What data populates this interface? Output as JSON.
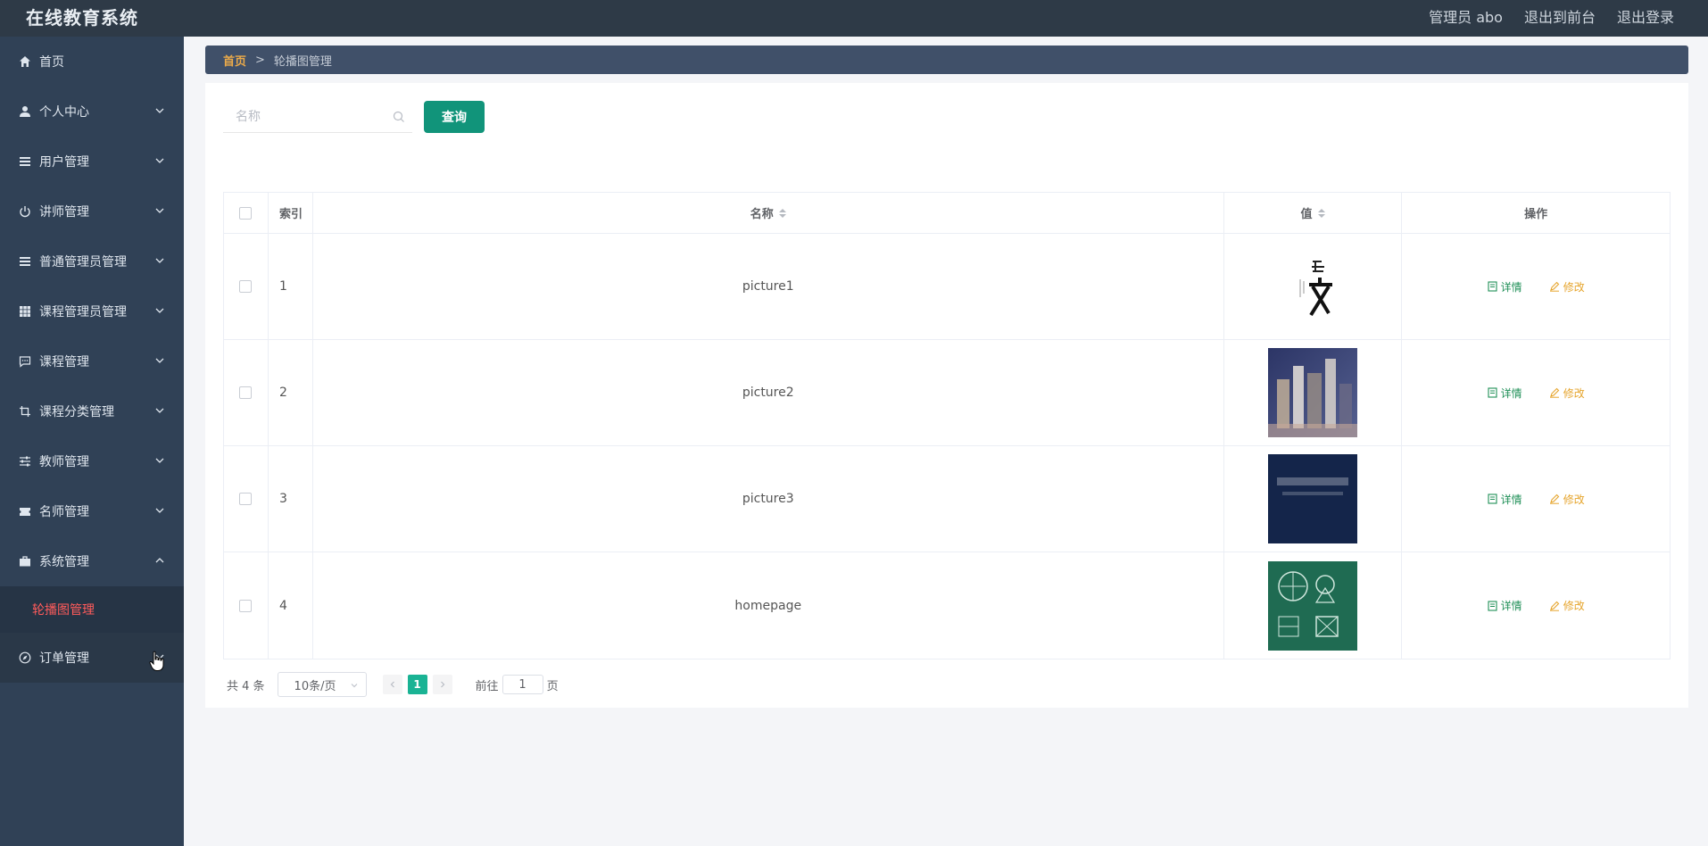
{
  "header": {
    "brand": "在线教育系统",
    "nav": [
      "管理员 abo",
      "退出到前台",
      "退出登录"
    ]
  },
  "sidebar": {
    "items": [
      {
        "label": "首页",
        "icon": "home-icon",
        "chevron": false
      },
      {
        "label": "个人中心",
        "icon": "user-icon",
        "chevron": "down"
      },
      {
        "label": "用户管理",
        "icon": "list-icon",
        "chevron": "down"
      },
      {
        "label": "讲师管理",
        "icon": "power-icon",
        "chevron": "down"
      },
      {
        "label": "普通管理员管理",
        "icon": "list-icon",
        "chevron": "down"
      },
      {
        "label": "课程管理员管理",
        "icon": "grid-icon",
        "chevron": "down"
      },
      {
        "label": "课程管理",
        "icon": "chat-icon",
        "chevron": "down"
      },
      {
        "label": "课程分类管理",
        "icon": "crop-icon",
        "chevron": "down"
      },
      {
        "label": "教师管理",
        "icon": "sliders-icon",
        "chevron": "down"
      },
      {
        "label": "名师管理",
        "icon": "ticket-icon",
        "chevron": "down"
      },
      {
        "label": "系统管理",
        "icon": "briefcase-icon",
        "chevron": "up"
      }
    ],
    "submenu": {
      "label": "轮播图管理"
    },
    "last_item": {
      "label": "订单管理",
      "icon": "compass-icon",
      "chevron": "down"
    }
  },
  "breadcrumb": {
    "home": "首页",
    "separator": ">",
    "current": "轮播图管理"
  },
  "search": {
    "placeholder": "名称",
    "value": "",
    "button": "查询"
  },
  "table": {
    "headers": {
      "index": "索引",
      "name": "名称",
      "value": "值",
      "ops": "操作"
    },
    "rows": [
      {
        "index": "1",
        "name": "picture1",
        "thumb": "calligraphy"
      },
      {
        "index": "2",
        "name": "picture2",
        "thumb": "building"
      },
      {
        "index": "3",
        "name": "picture3",
        "thumb": "dark-title"
      },
      {
        "index": "4",
        "name": "homepage",
        "thumb": "chalkboard"
      }
    ],
    "detail_label": "详情",
    "edit_label": "修改"
  },
  "pager": {
    "total": "共 4 条",
    "page_size": "10条/页",
    "current_page": "1",
    "goto_prefix": "前往",
    "goto_value": "1",
    "goto_suffix": "页"
  },
  "colors": {
    "header_bg": "#2e3a47",
    "sidebar_bg": "#304156",
    "breadcrumb_bg": "#405069",
    "accent": "#11947a",
    "active_submenu": "#ff5b5b",
    "detail": "#1f8f57",
    "edit": "#e6a52d"
  }
}
